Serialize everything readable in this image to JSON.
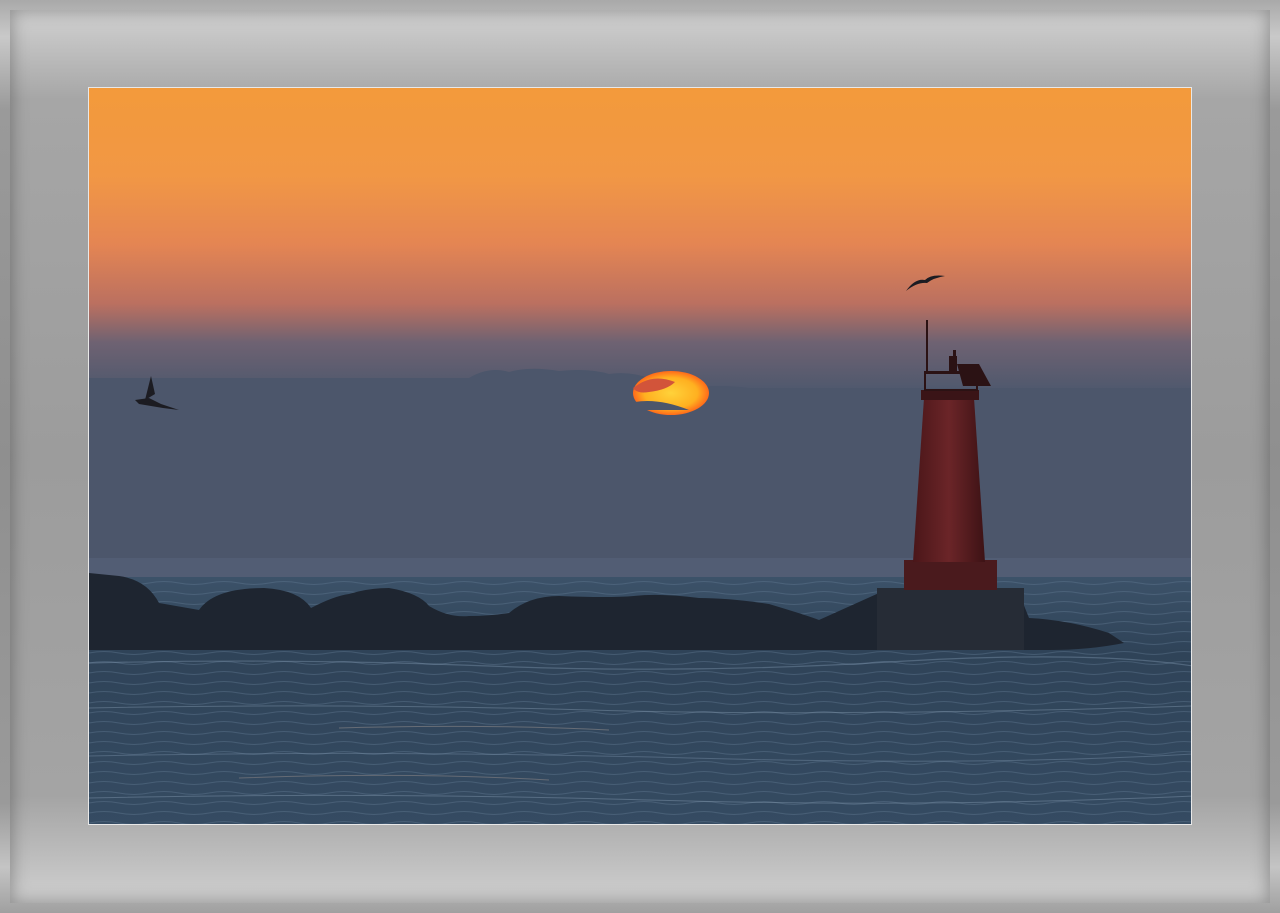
{
  "scene": {
    "subject": "lighthouse",
    "sky_colors": [
      "#f49a3c",
      "#ee8a47",
      "#c9775f",
      "#4b5770",
      "#4a5468"
    ],
    "sea_colors": [
      "#34495f",
      "#2b3d52",
      "#3a4f67"
    ],
    "sun_color": "#ffb425",
    "lighthouse_color": "#5a1f22"
  },
  "frame": {
    "color": "#9c9c9c",
    "mat_border_color": "#e8e8e8"
  }
}
